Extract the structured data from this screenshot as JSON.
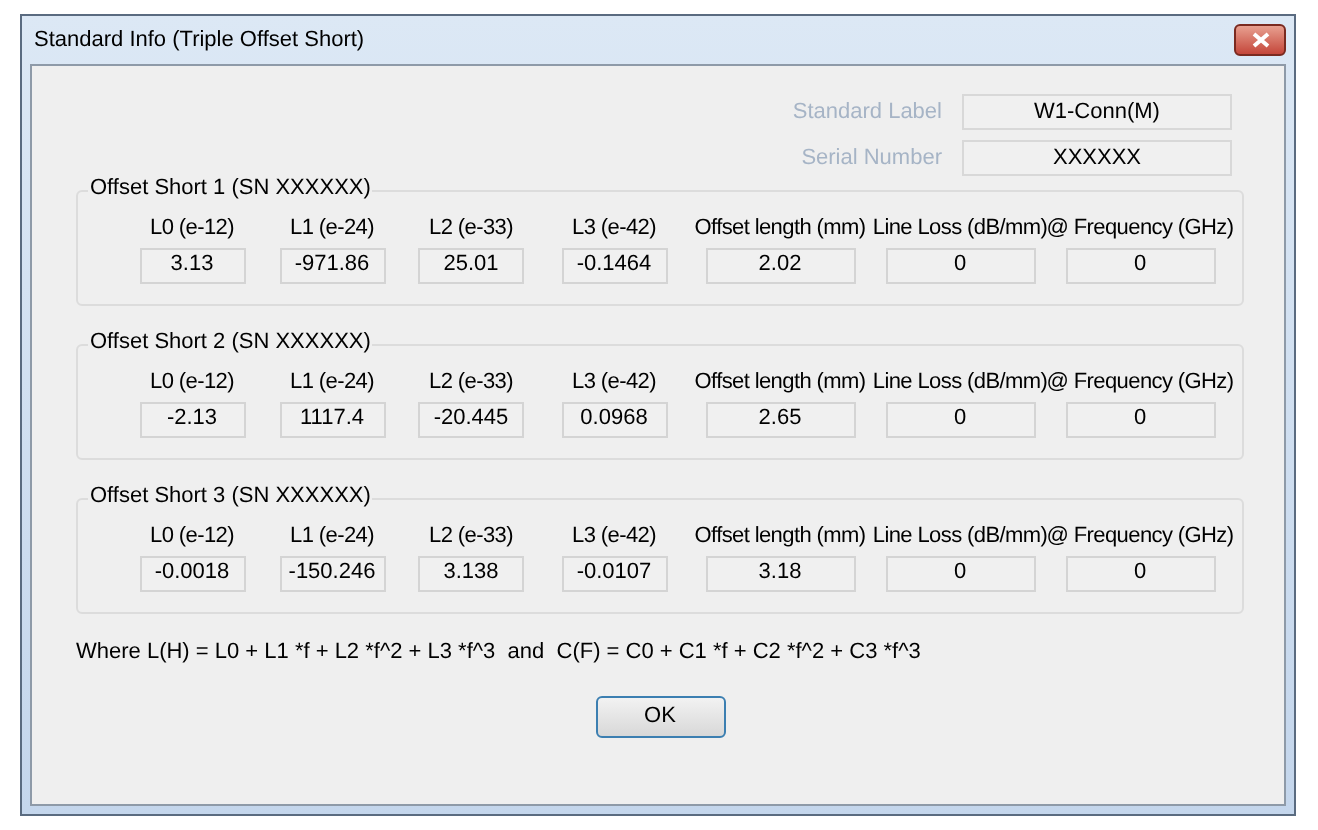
{
  "window": {
    "title": "Standard Info (Triple Offset Short)"
  },
  "info_fields": [
    {
      "label": "Standard Label",
      "value": "W1-Conn(M)",
      "disabled": true
    },
    {
      "label": "Serial Number",
      "value": "XXXXXX",
      "disabled": true
    }
  ],
  "groups": [
    {
      "title": "Offset Short 1 (SN XXXXXX)",
      "fields": [
        {
          "label": "L0 (e-12)",
          "value": "3.13"
        },
        {
          "label": "L1 (e-24)",
          "value": "-971.86"
        },
        {
          "label": "L2 (e-33)",
          "value": "25.01"
        },
        {
          "label": "L3 (e-42)",
          "value": "-0.1464"
        },
        {
          "label": "Offset length (mm)",
          "value": "2.02"
        },
        {
          "label": "Line Loss (dB/mm)",
          "value": "0"
        },
        {
          "label": "@ Frequency (GHz)",
          "value": "0"
        }
      ]
    },
    {
      "title": "Offset Short 2 (SN XXXXXX)",
      "fields": [
        {
          "label": "L0 (e-12)",
          "value": "-2.13"
        },
        {
          "label": "L1 (e-24)",
          "value": "1117.4"
        },
        {
          "label": "L2 (e-33)",
          "value": "-20.445"
        },
        {
          "label": "L3 (e-42)",
          "value": "0.0968"
        },
        {
          "label": "Offset length (mm)",
          "value": "2.65"
        },
        {
          "label": "Line Loss (dB/mm)",
          "value": "0"
        },
        {
          "label": "@ Frequency (GHz)",
          "value": "0"
        }
      ]
    },
    {
      "title": "Offset Short 3 (SN XXXXXX)",
      "fields": [
        {
          "label": "L0 (e-12)",
          "value": "-0.0018"
        },
        {
          "label": "L1 (e-24)",
          "value": "-150.246"
        },
        {
          "label": "L2 (e-33)",
          "value": "3.138"
        },
        {
          "label": "L3 (e-42)",
          "value": "-0.0107"
        },
        {
          "label": "Offset length (mm)",
          "value": "3.18"
        },
        {
          "label": "Line Loss (dB/mm)",
          "value": "0"
        },
        {
          "label": "@ Frequency (GHz)",
          "value": "0"
        }
      ]
    }
  ],
  "formula": "Where L(H) = L0 + L1 *f + L2 *f^2 + L3 *f^3  and  C(F) = C0 + C1 *f + C2 *f^2 + C3 *f^3",
  "buttons": [
    "OK"
  ]
}
